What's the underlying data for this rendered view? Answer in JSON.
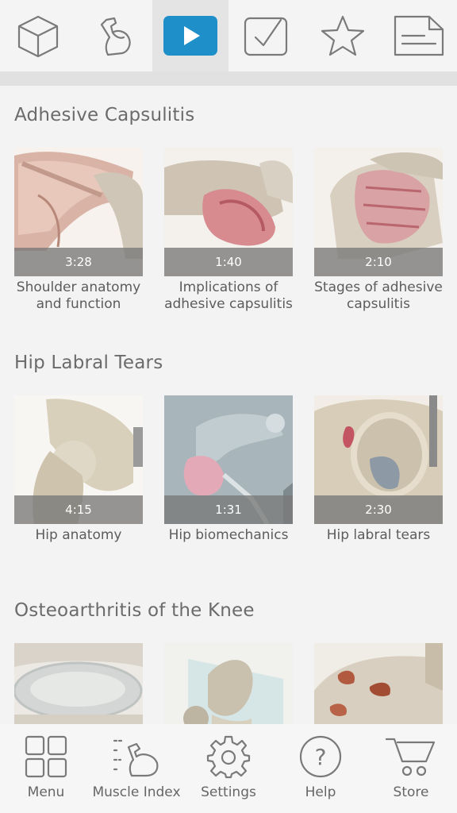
{
  "top_tabs": [
    {
      "name": "3d-model",
      "icon": "cube-icon"
    },
    {
      "name": "muscles",
      "icon": "flexed-arm-icon"
    },
    {
      "name": "videos",
      "icon": "play-icon",
      "active": true
    },
    {
      "name": "quiz",
      "icon": "checkbox-icon"
    },
    {
      "name": "favorites",
      "icon": "star-icon"
    },
    {
      "name": "notes",
      "icon": "note-icon"
    }
  ],
  "colors": {
    "accent": "#1e8fc9",
    "icon": "#7a7a7a"
  },
  "sections": [
    {
      "title": "Adhesive Capsulitis",
      "videos": [
        {
          "duration": "3:28",
          "title_line1": "Shoulder anatomy",
          "title_line2": "and function"
        },
        {
          "duration": "1:40",
          "title_line1": "Implications of",
          "title_line2": "adhesive capsulitis"
        },
        {
          "duration": "2:10",
          "title_line1": "Stages of adhesive",
          "title_line2": "capsulitis"
        }
      ]
    },
    {
      "title": "Hip Labral Tears",
      "videos": [
        {
          "duration": "4:15",
          "title_line1": "Hip anatomy",
          "title_line2": ""
        },
        {
          "duration": "1:31",
          "title_line1": "Hip biomechanics",
          "title_line2": ""
        },
        {
          "duration": "2:30",
          "title_line1": "Hip labral tears",
          "title_line2": ""
        }
      ]
    },
    {
      "title": "Osteoarthritis of the Knee",
      "videos": [
        {
          "duration": "",
          "title_line1": "",
          "title_line2": ""
        },
        {
          "duration": "",
          "title_line1": "",
          "title_line2": ""
        },
        {
          "duration": "",
          "title_line1": "",
          "title_line2": ""
        }
      ]
    }
  ],
  "bottom_nav": [
    {
      "label": "Menu",
      "icon": "grid-icon"
    },
    {
      "label": "Muscle Index",
      "icon": "muscle-list-icon"
    },
    {
      "label": "Settings",
      "icon": "gear-icon"
    },
    {
      "label": "Help",
      "icon": "question-icon"
    },
    {
      "label": "Store",
      "icon": "cart-icon"
    }
  ]
}
